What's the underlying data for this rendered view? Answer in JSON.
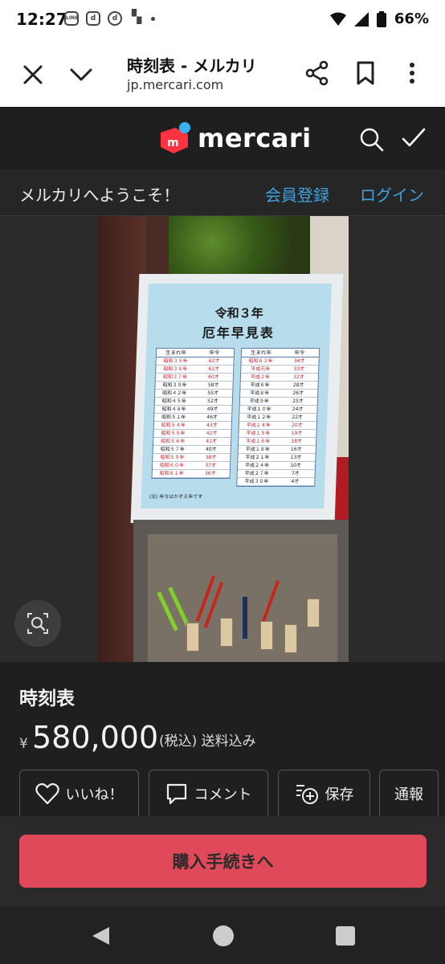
{
  "status": {
    "time": "12:27",
    "battery": "66%",
    "notif_icons": [
      "LINE",
      "d",
      "d",
      "▚"
    ]
  },
  "browser": {
    "title": "時刻表 - メルカリ",
    "url": "jp.mercari.com"
  },
  "header": {
    "logo_text": "mercari",
    "brand_color": "#ff333f"
  },
  "welcome": {
    "message": "メルカリへようこそ！",
    "register": "会員登録",
    "login": "ログイン"
  },
  "photo": {
    "sign_title_line1": "令和３年",
    "sign_title_line2": "厄年早見表",
    "col_birth": "生まれ年",
    "col_age": "年令",
    "left_rows": [
      {
        "year": "昭和３５年",
        "age": "62才",
        "red": true
      },
      {
        "year": "昭和３６年",
        "age": "61才",
        "red": true
      },
      {
        "year": "昭和３７年",
        "age": "60才",
        "red": true
      },
      {
        "year": "昭和３９年",
        "age": "58才",
        "red": false
      },
      {
        "year": "昭和４２年",
        "age": "55才",
        "red": false
      },
      {
        "year": "昭和４５年",
        "age": "52才",
        "red": false
      },
      {
        "year": "昭和４８年",
        "age": "49才",
        "red": false
      },
      {
        "year": "昭和５１年",
        "age": "46才",
        "red": false
      },
      {
        "year": "昭和５４年",
        "age": "43才",
        "red": true
      },
      {
        "year": "昭和５５年",
        "age": "42才",
        "red": true
      },
      {
        "year": "昭和５６年",
        "age": "41才",
        "red": true
      },
      {
        "year": "昭和５７年",
        "age": "40才",
        "red": false
      },
      {
        "year": "昭和５９年",
        "age": "38才",
        "red": true
      },
      {
        "year": "昭和６０年",
        "age": "37才",
        "red": true
      },
      {
        "year": "昭和６１年",
        "age": "36才",
        "red": true
      }
    ],
    "right_rows": [
      {
        "year": "昭和６３年",
        "age": "34才",
        "red": true
      },
      {
        "year": "平成元年",
        "age": "33才",
        "red": true
      },
      {
        "year": "平成２年",
        "age": "32才",
        "red": true
      },
      {
        "year": "平成６年",
        "age": "28才",
        "red": false
      },
      {
        "year": "平成８年",
        "age": "26才",
        "red": false
      },
      {
        "year": "平成９年",
        "age": "25才",
        "red": false
      },
      {
        "year": "平成１０年",
        "age": "24才",
        "red": false
      },
      {
        "year": "平成１２年",
        "age": "22才",
        "red": false
      },
      {
        "year": "平成１４年",
        "age": "20才",
        "red": true
      },
      {
        "year": "平成１５年",
        "age": "19才",
        "red": true
      },
      {
        "year": "平成１６年",
        "age": "18才",
        "red": true
      },
      {
        "year": "平成１８年",
        "age": "16才",
        "red": false
      },
      {
        "year": "平成２１年",
        "age": "13才",
        "red": false
      },
      {
        "year": "平成２４年",
        "age": "10才",
        "red": false
      },
      {
        "year": "平成２７年",
        "age": "7才",
        "red": false
      },
      {
        "year": "平成３０年",
        "age": "4才",
        "red": false
      }
    ],
    "note": "(注) 年令はかぞえ年です"
  },
  "product": {
    "title": "時刻表",
    "currency": "¥",
    "price": "580,000",
    "tax_shipping": "(税込) 送料込み"
  },
  "actions": {
    "like": "いいね！",
    "comment": "コメント",
    "save": "保存",
    "report": "通報"
  },
  "buy": {
    "label": "購入手続きへ"
  }
}
